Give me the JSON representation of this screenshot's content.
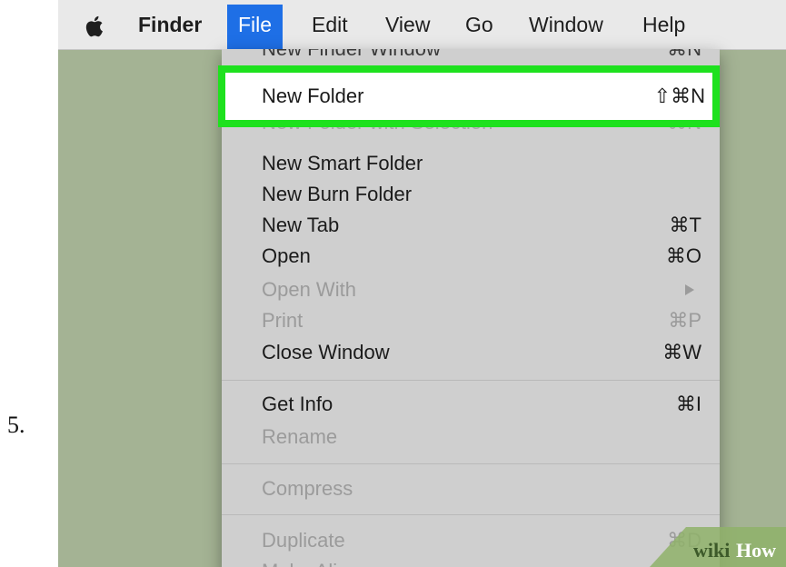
{
  "step_number": "5.",
  "menubar": {
    "apple_icon": "apple-icon",
    "items": [
      "Finder",
      "File",
      "Edit",
      "View",
      "Go",
      "Window",
      "Help"
    ],
    "active_item": "File",
    "active_color": "#1e6fe6"
  },
  "file_menu": {
    "top_cut_item": {
      "label": "New Finder Window",
      "shortcut": "⌘N"
    },
    "highlighted_item": {
      "label": "New Folder",
      "shortcut": "⇧⌘N",
      "highlight_color": "#1ee11e"
    },
    "faded_cut_item": {
      "label": "New Folder with Selection",
      "shortcut": "⌃⌘N"
    },
    "items": [
      {
        "label": "New Smart Folder",
        "shortcut": "",
        "enabled": true
      },
      {
        "label": "New Burn Folder",
        "shortcut": "",
        "enabled": true
      },
      {
        "label": "New Tab",
        "shortcut": "⌘T",
        "enabled": true
      },
      {
        "label": "Open",
        "shortcut": "⌘O",
        "enabled": true
      },
      {
        "label": "Open With",
        "shortcut": "",
        "enabled": false,
        "submenu": true
      },
      {
        "label": "Print",
        "shortcut": "⌘P",
        "enabled": false
      },
      {
        "label": "Close Window",
        "shortcut": "⌘W",
        "enabled": true
      }
    ],
    "group2": [
      {
        "label": "Get Info",
        "shortcut": "⌘I",
        "enabled": true
      },
      {
        "label": "Rename",
        "shortcut": "",
        "enabled": false
      }
    ],
    "group3": [
      {
        "label": "Compress",
        "shortcut": "",
        "enabled": false
      }
    ],
    "group4": [
      {
        "label": "Duplicate",
        "shortcut": "⌘D",
        "enabled": false
      }
    ],
    "bottom_cut_item": {
      "label": "Make Alias"
    }
  },
  "watermark": {
    "wiki": "wiki",
    "how": "How"
  }
}
